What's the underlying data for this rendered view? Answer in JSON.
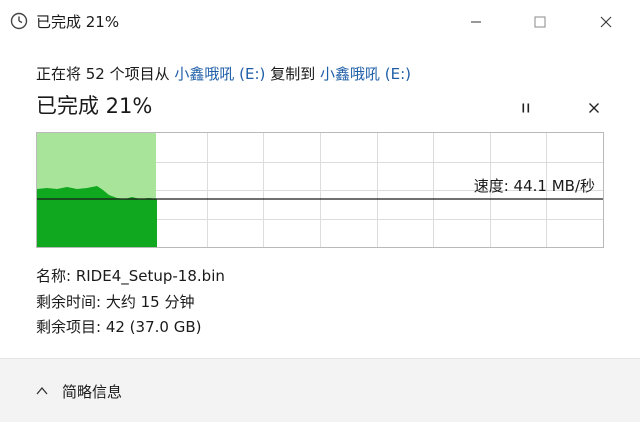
{
  "window": {
    "title": "已完成 21%"
  },
  "description": {
    "prefix": "正在将 52 个项目从 ",
    "source": "小鑫哦吼 (E:)",
    "middle": " 复制到 ",
    "destination": "小鑫哦吼 (E:)"
  },
  "progress": {
    "title": "已完成 21%",
    "percent": 21,
    "speed_label": "速度: 44.1 MB/秒"
  },
  "details": {
    "name": "名称: RIDE4_Setup-18.bin",
    "time_remaining": "剩余时间: 大约 15 分钟",
    "items_remaining": "剩余项目: 42 (37.0 GB)"
  },
  "footer": {
    "toggle_label": "简略信息"
  },
  "colors": {
    "progress_fill": "#a8e59a",
    "speed_fill": "#10a81e",
    "grid": "#dcdcdc",
    "link": "#1f5fa8"
  },
  "icons": {
    "title": "copy-progress-icon",
    "minimize": "minimize-icon",
    "maximize": "maximize-icon",
    "close": "close-icon",
    "pause": "pause-icon",
    "cancel": "cancel-icon",
    "toggle": "chevron-up-icon"
  }
}
